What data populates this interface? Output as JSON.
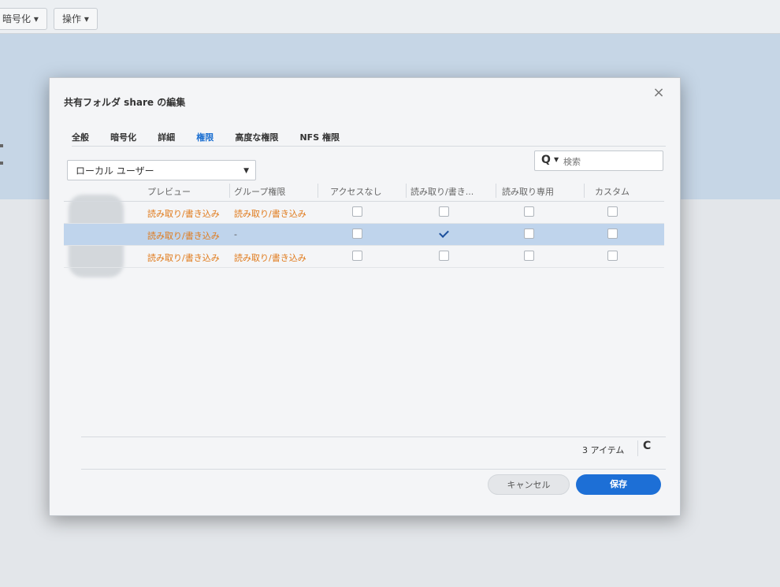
{
  "background": {
    "toolbar_buttons": [
      "暗号化 ▾",
      "操作 ▾"
    ]
  },
  "dialog": {
    "title": "共有フォルダ share の編集",
    "close_glyph": "×",
    "tabs": [
      {
        "label": "全般",
        "active": false
      },
      {
        "label": "暗号化",
        "active": false
      },
      {
        "label": "詳細",
        "active": false
      },
      {
        "label": "権限",
        "active": true
      },
      {
        "label": "高度な権限",
        "active": false
      },
      {
        "label": "NFS 権限",
        "active": false
      }
    ],
    "user_type_select": {
      "value": "ローカル ユーザー",
      "caret": "▼"
    },
    "search": {
      "placeholder": "検索",
      "icon": "search-icon"
    },
    "table": {
      "columns": [
        "プレビュー",
        "グループ権限",
        "アクセスなし",
        "読み取り/書き...",
        "読み取り専用",
        "カスタム"
      ],
      "rows": [
        {
          "preview": "読み取り/書き込み",
          "group_permission": "読み取り/書き込み",
          "no_access": false,
          "read_write": false,
          "read_only": false,
          "custom": false
        },
        {
          "preview": "読み取り/書き込み",
          "group_permission": "-",
          "no_access": false,
          "read_write": true,
          "read_only": false,
          "custom": false
        },
        {
          "preview": "読み取り/書き込み",
          "group_permission": "読み取り/書き込み",
          "no_access": false,
          "read_write": false,
          "read_only": false,
          "custom": false
        }
      ]
    },
    "footer": {
      "item_count": "3 アイテム",
      "refresh_glyph": "C",
      "cancel_label": "キャンセル",
      "save_label": "保存"
    }
  },
  "colors": {
    "accent": "#1d6fd6",
    "permission_text": "#e07a1b",
    "selected_row": "#bfd4ec"
  }
}
